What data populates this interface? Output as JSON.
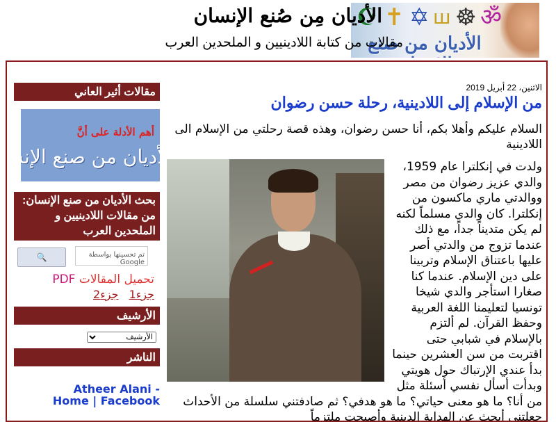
{
  "header": {
    "title": "الأديان مِن صُنع الإنسان",
    "description": "مقالات من كتابة اللادينيين و الملحدين العرب",
    "image_text": "الأديان من صنع الإنسان",
    "symbols": [
      "☪",
      "✝",
      "✡",
      "🕎",
      "☸",
      "ॐ"
    ]
  },
  "post": {
    "date": "الاثنين، 22 أبريل 2019",
    "title": "من الإسلام إلى اللادينية، رحلة حسن رضوان",
    "intro": "السلام عليكم وأهلا بكم، أنا حسن رضوان، وهذه قصة رحلتي من الإسلام الى اللادينية",
    "body": "ولدت في إنكلترا عام 1959، والدي عزيز رضوان  من مصر ووالدتي ماري ماكسون من إنكلترا. كان والدي مسلماً لكنه لم يكن متديناً جداً، مع ذلك عندما تزوج من والدتي أصر عليها باعتناق الإسلام وتربينا على دين الإسلام. عندما كنا صغارا استأجر والدي شيخا تونسيا لتعليمنا اللغة العربية وحفظ القرآن. لم ألتزم بالإسلام في شبابي حتى اقتربت من سن العشرين حينما بدأ عندي الإرتباك حول هويتي وبدأت أسأل نفسي أسئلة مثل من أنا؟ ما هو معنى حياتي؟ ما هو هدفي؟ ثم صادفتني سلسلة من الأحداث جعلتني أبحث عن الهداية الدينية وأصبحت ملتزماً"
  },
  "sidebar": {
    "widget1_title": "مقالات أثير العاني",
    "promo_line1": "أهم الأدلة على أنَّ",
    "promo_line2": "الأديان من صنع الإنسان",
    "widget2_title": "بحث الأديان من صنع الإنسان: من مقالات اللادينيين و الملحدين العرب",
    "search_placeholder": "تم تحسينها بواسطة Google",
    "search_button": "🔍",
    "pdf_label_ar": "تحميل المقالات",
    "pdf_label_en": "PDF",
    "pdf_part1": "جزء1",
    "pdf_part2": "جزء2",
    "archive_title": "الأرشيف",
    "archive_selected": "الأرشيف",
    "publisher_title": "الناشر",
    "fb_link": "Atheer Alani - Home | Facebook"
  },
  "colors": {
    "widget_header": "#7a1f1f",
    "frame_border": "#8b1a1a",
    "post_title": "#1a3ccc",
    "link": "#a01a1a"
  }
}
